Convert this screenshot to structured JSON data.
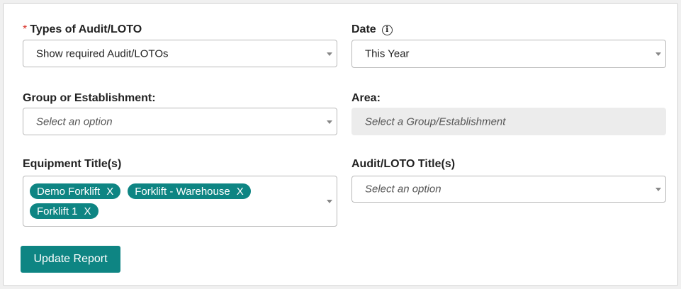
{
  "form": {
    "audit_types": {
      "label": "Types of Audit/LOTO",
      "required_marker": "*",
      "value": "Show required Audit/LOTOs"
    },
    "date": {
      "label": "Date",
      "info_glyph": "ⓘ",
      "value": "This Year"
    },
    "group": {
      "label": "Group or Establishment:",
      "placeholder": "Select an option"
    },
    "area": {
      "label": "Area:",
      "placeholder": "Select a Group/Establishment"
    },
    "equipment": {
      "label": "Equipment Title(s)",
      "tags": [
        {
          "label": "Demo Forklift",
          "remove": "X"
        },
        {
          "label": "Forklift - Warehouse",
          "remove": "X"
        },
        {
          "label": "Forklift 1",
          "remove": "X"
        }
      ]
    },
    "audit_titles": {
      "label": "Audit/LOTO Title(s)",
      "placeholder": "Select an option"
    },
    "submit_label": "Update Report"
  },
  "colors": {
    "accent": "#0e8583",
    "required": "#d9342b",
    "disabled_bg": "#ececec"
  }
}
